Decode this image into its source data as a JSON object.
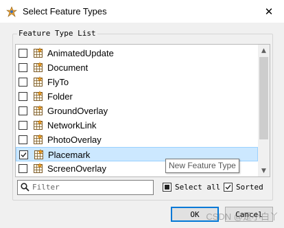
{
  "window": {
    "title": "Select Feature Types",
    "close_glyph": "✕"
  },
  "group": {
    "label": "Feature Type List"
  },
  "list": {
    "items": [
      {
        "label": "AnimatedUpdate",
        "checked": false,
        "selected": false
      },
      {
        "label": "Document",
        "checked": false,
        "selected": false
      },
      {
        "label": "FlyTo",
        "checked": false,
        "selected": false
      },
      {
        "label": "Folder",
        "checked": false,
        "selected": false
      },
      {
        "label": "GroundOverlay",
        "checked": false,
        "selected": false
      },
      {
        "label": "NetworkLink",
        "checked": false,
        "selected": false
      },
      {
        "label": "PhotoOverlay",
        "checked": false,
        "selected": false
      },
      {
        "label": "Placemark",
        "checked": true,
        "selected": true
      },
      {
        "label": "ScreenOverlay",
        "checked": false,
        "selected": false
      }
    ]
  },
  "tooltip": {
    "text": "New Feature Type"
  },
  "filter": {
    "placeholder": "Filter",
    "value": ""
  },
  "options": {
    "select_all_label": "Select all",
    "select_all_checked": "indeterminate",
    "sorted_label": "Sorted",
    "sorted_checked": true
  },
  "buttons": {
    "ok_label": "OK",
    "cancel_label": "Cancel"
  },
  "watermark": {
    "text": "CSDN @是小白丫"
  },
  "colors": {
    "selection_bg": "#cce8ff",
    "selection_border": "#99d1ff",
    "default_button_border": "#0078d7"
  }
}
